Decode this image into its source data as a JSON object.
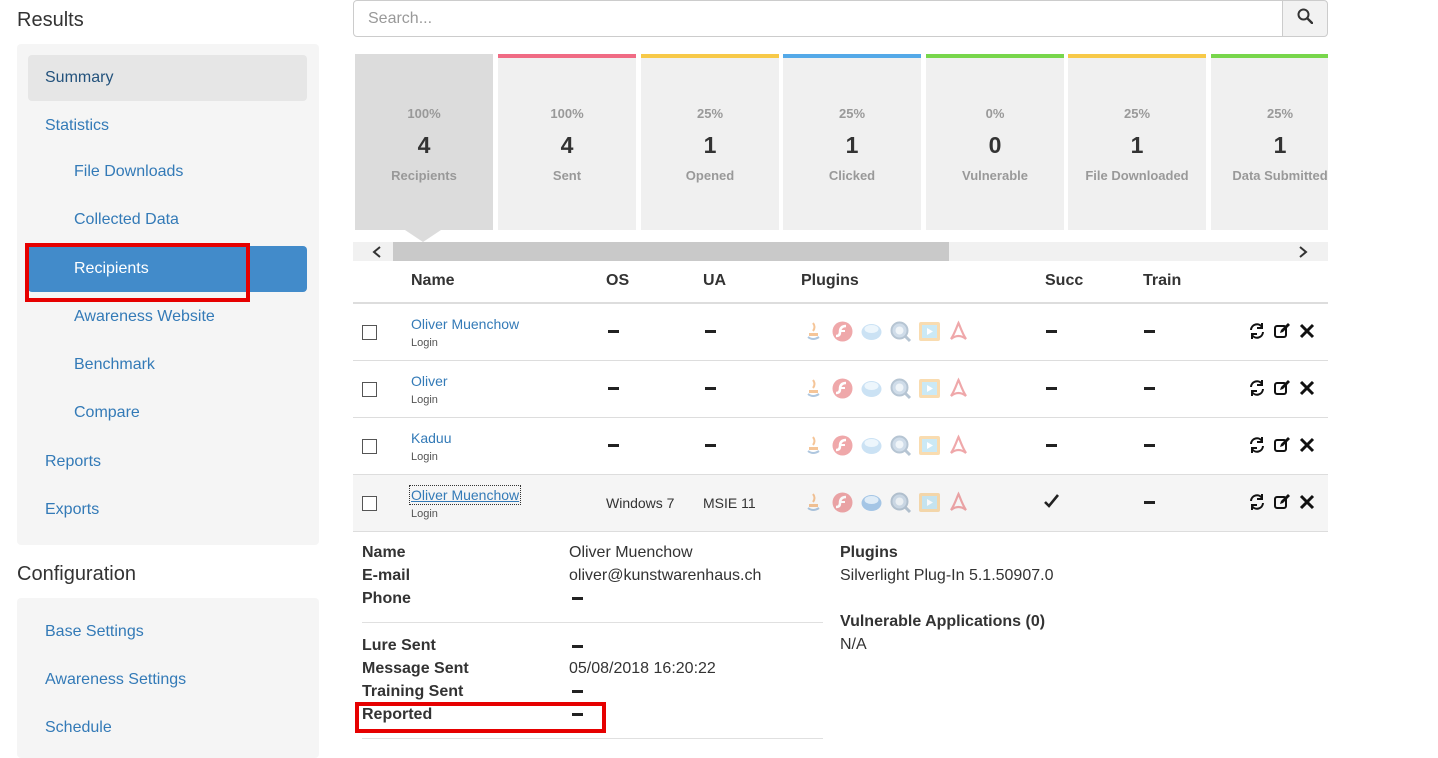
{
  "sidebar": {
    "results_title": "Results",
    "results_items": [
      {
        "label": "Summary"
      },
      {
        "label": "Statistics"
      },
      {
        "label": "File Downloads"
      },
      {
        "label": "Collected Data"
      },
      {
        "label": "Recipients"
      },
      {
        "label": "Awareness Website"
      },
      {
        "label": "Benchmark"
      },
      {
        "label": "Compare"
      },
      {
        "label": "Reports"
      },
      {
        "label": "Exports"
      }
    ],
    "config_title": "Configuration",
    "config_items": [
      {
        "label": "Base Settings"
      },
      {
        "label": "Awareness Settings"
      },
      {
        "label": "Schedule"
      }
    ]
  },
  "search": {
    "placeholder": "Search...",
    "value": "",
    "button_icon": "search-icon"
  },
  "stats": [
    {
      "pct": "100%",
      "count": "4",
      "label": "Recipients",
      "color": "#dcdcdc"
    },
    {
      "pct": "100%",
      "count": "4",
      "label": "Sent",
      "color": "#f06b84"
    },
    {
      "pct": "25%",
      "count": "1",
      "label": "Opened",
      "color": "#f7c948"
    },
    {
      "pct": "25%",
      "count": "1",
      "label": "Clicked",
      "color": "#54a9e8"
    },
    {
      "pct": "0%",
      "count": "0",
      "label": "Vulnerable",
      "color": "#78d64b"
    },
    {
      "pct": "25%",
      "count": "1",
      "label": "File Downloaded",
      "color": "#f7c948"
    },
    {
      "pct": "25%",
      "count": "1",
      "label": "Data Submitted",
      "color": "#78d64b"
    }
  ],
  "table": {
    "headers": {
      "name": "Name",
      "os": "OS",
      "ua": "UA",
      "plugins": "Plugins",
      "succ": "Succ",
      "train": "Train"
    },
    "plugin_icons": [
      "java-icon",
      "flash-icon",
      "silverlight-icon",
      "quicktime-icon",
      "media-player-icon",
      "pdf-icon"
    ],
    "action_icons": [
      "refresh-icon",
      "edit-icon",
      "delete-icon"
    ],
    "rows": [
      {
        "name": "Oliver Muenchow",
        "sub": "Login",
        "os": "",
        "ua": "",
        "succ": false
      },
      {
        "name": "Oliver",
        "sub": "Login",
        "os": "",
        "ua": "",
        "succ": false
      },
      {
        "name": "Kaduu",
        "sub": "Login",
        "os": "",
        "ua": "",
        "succ": false
      },
      {
        "name": "Oliver Muenchow",
        "sub": "Login",
        "os": "Windows 7",
        "ua": "MSIE 11",
        "succ": true
      }
    ]
  },
  "details": {
    "name_label": "Name",
    "name_value": "Oliver Muenchow",
    "email_label": "E-mail",
    "email_value": "oliver@kunstwarenhaus.ch",
    "phone_label": "Phone",
    "lure_label": "Lure Sent",
    "message_label": "Message Sent",
    "message_value": "05/08/2018 16:20:22",
    "training_label": "Training Sent",
    "reported_label": "Reported",
    "plugins_label": "Plugins",
    "plugins_value": "Silverlight Plug-In 5.1.50907.0",
    "vuln_label": "Vulnerable Applications (0)",
    "vuln_value": "N/A"
  },
  "colors": {
    "link": "#337ab7",
    "active": "#428bca",
    "highlight_box": "#e60000"
  }
}
